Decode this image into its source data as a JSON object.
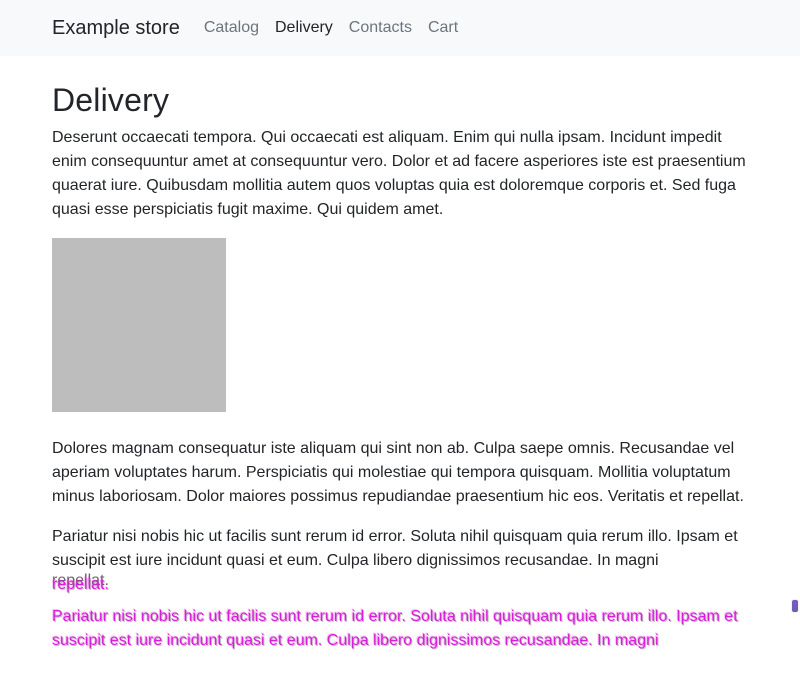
{
  "navbar": {
    "brand": "Example store",
    "links": [
      {
        "label": "Catalog",
        "active": false
      },
      {
        "label": "Delivery",
        "active": true
      },
      {
        "label": "Contacts",
        "active": false
      },
      {
        "label": "Cart",
        "active": false
      }
    ]
  },
  "page": {
    "title": "Delivery",
    "paragraph1": "Deserunt occaecati tempora. Qui occaecati est aliquam. Enim qui nulla ipsam. Incidunt impedit enim consequuntur amet at consequuntur vero. Dolor et ad facere asperiores iste est praesentium quaerat iure. Quibusdam mollitia autem quos voluptas quia est doloremque corporis et. Sed fuga quasi esse perspiciatis fugit maxime. Qui quidem amet.",
    "paragraph2": "Dolores magnam consequatur iste aliquam qui sint non ab. Culpa saepe omnis. Recusandae vel aperiam voluptates harum. Perspiciatis qui molestiae qui tempora quisquam. Mollitia voluptatum minus laboriosam. Dolor maiores possimus repudiandae praesentium hic eos. Veritatis et repellat.",
    "paragraph3_main": "Pariatur nisi nobis hic ut facilis sunt rerum id error. Soluta nihil quisquam quia rerum illo. Ipsam et suscipit est iure incidunt quasi et eum. Culpa libero dignissimos recusandae. In magni",
    "paragraph3_tail": "repellat.",
    "paragraph4_overlay": "Pariatur nisi nobis hic ut facilis sunt rerum id error. Soluta nihil quisquam quia rerum illo. Ipsam et suscipit est iure incidunt quasi et eum. Culpa libero dignissimos recusandae. In magni"
  },
  "colors": {
    "navbar_bg": "#f8f9fa",
    "text": "#212529",
    "muted": "#6c757d",
    "placeholder_image": "#bdbdbd",
    "overlay_magenta": "#d71fd7"
  }
}
